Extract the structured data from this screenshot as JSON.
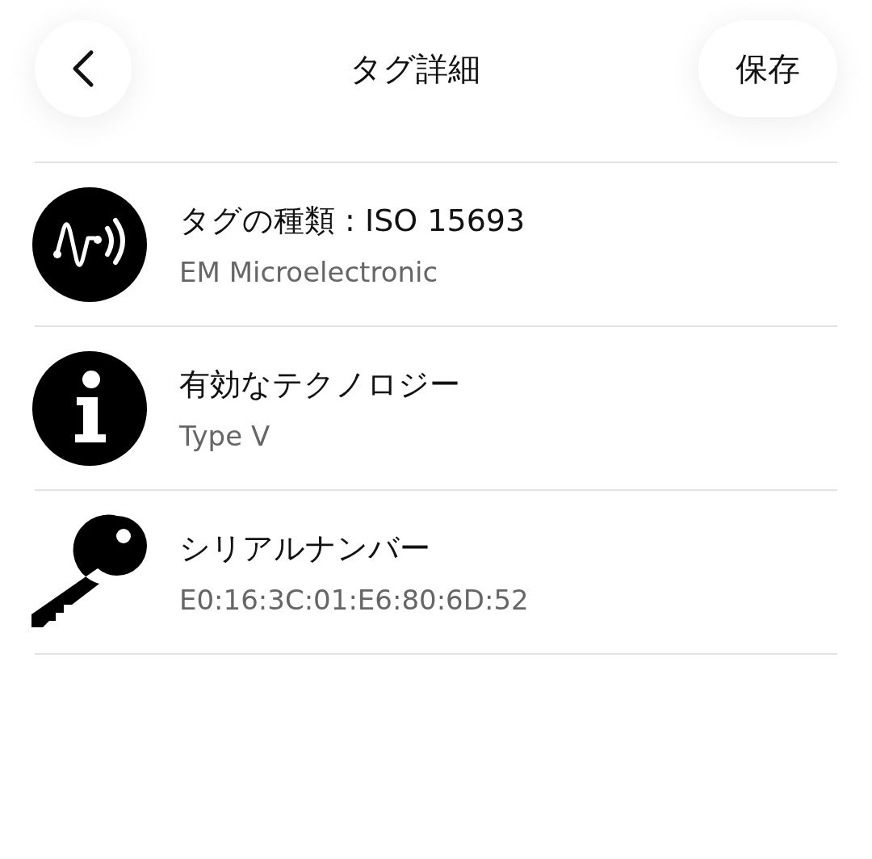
{
  "header": {
    "title": "タグ詳細",
    "save_label": "保存"
  },
  "items": [
    {
      "kind": "nfc",
      "title": "タグの種類 : ISO 15693",
      "subtitle": "EM Microelectronic"
    },
    {
      "kind": "info",
      "title": "有効なテクノロジー",
      "subtitle": "Type V"
    },
    {
      "kind": "key",
      "title": "シリアルナンバー",
      "subtitle": "E0:16:3C:01:E6:80:6D:52"
    }
  ]
}
